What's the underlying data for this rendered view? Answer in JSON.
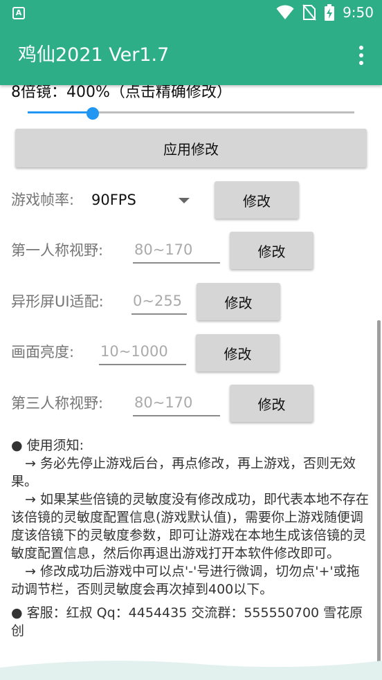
{
  "status": {
    "time": "9:50",
    "app_icon": "A"
  },
  "appbar": {
    "title": "鸡仙2021 Ver1.7"
  },
  "scope": {
    "label": "8倍镜：400%（点击精确修改）",
    "percent": 20
  },
  "apply_button": "应用修改",
  "fps": {
    "label": "游戏帧率:",
    "value": "90FPS",
    "button": "修改"
  },
  "first_person": {
    "label": "第一人称视野:",
    "placeholder": "80~170",
    "button": "修改"
  },
  "notch_ui": {
    "label": "异形屏UI适配:",
    "placeholder": "0~255",
    "button": "修改"
  },
  "brightness": {
    "label": "画面亮度:",
    "placeholder": "10~1000",
    "button": "修改"
  },
  "third_person": {
    "label": "第三人称视野:",
    "placeholder": "80~170",
    "button": "修改"
  },
  "notice": {
    "heading": "● 使用须知:",
    "lines": [
      "→ 务必先停止游戏后台，再点修改，再上游戏，否则无效果。",
      "→ 如果某些倍镜的灵敏度没有修改成功，即代表本地不存在该倍镜的灵敏度配置信息(游戏默认值)，需要你上游戏随便调度该倍镜下的灵敏度参数，即可让游戏在本地生成该倍镜的灵敏度配置信息，然后你再退出游戏打开本软件修改即可。",
      "→ 修改成功后游戏中可以点'-'号进行微调，切勿点'+'或拖动调节栏，否则灵敏度会再次掉到400以下。"
    ],
    "contact": "● 客服：红叔 Qq：4454435 交流群：555550700 雪花原创"
  },
  "colors": {
    "primary": "#2EAE87",
    "accent": "#2196F3",
    "button": "#D6D6D6"
  }
}
